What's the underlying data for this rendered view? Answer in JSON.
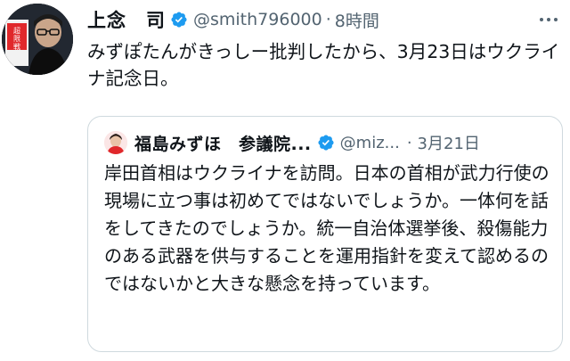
{
  "tweet": {
    "author_name": "上念　司",
    "handle": "@smith796000",
    "separator": "·",
    "time": "8時間",
    "text": "みずぽたんがきっしー批判したから、3月23日はウクライナ記念日。",
    "verified": true,
    "avatar_caption": "超限戦"
  },
  "quoted_tweet": {
    "author_name": "福島みずほ　参議院...",
    "handle": "@miz...",
    "separator": "·",
    "time": "3月21日",
    "text": "岸田首相はウクライナを訪問。日本の首相が武力行使の現場に立つ事は初めてではないでしょうか。一体何を話をしてきたのでしょうか。統一自治体選挙後、殺傷能力のある武器を供与することを運用指針を変えて認めるのではないかと大きな懸念を持っています。",
    "verified": true
  },
  "colors": {
    "verified_blue": "#1d9bf0",
    "secondary_text": "#536471",
    "border": "#cfd9de",
    "caption_red": "#e0282b"
  },
  "icons": {
    "more": "more-horizontal-icon",
    "verified": "verified-badge-icon"
  }
}
